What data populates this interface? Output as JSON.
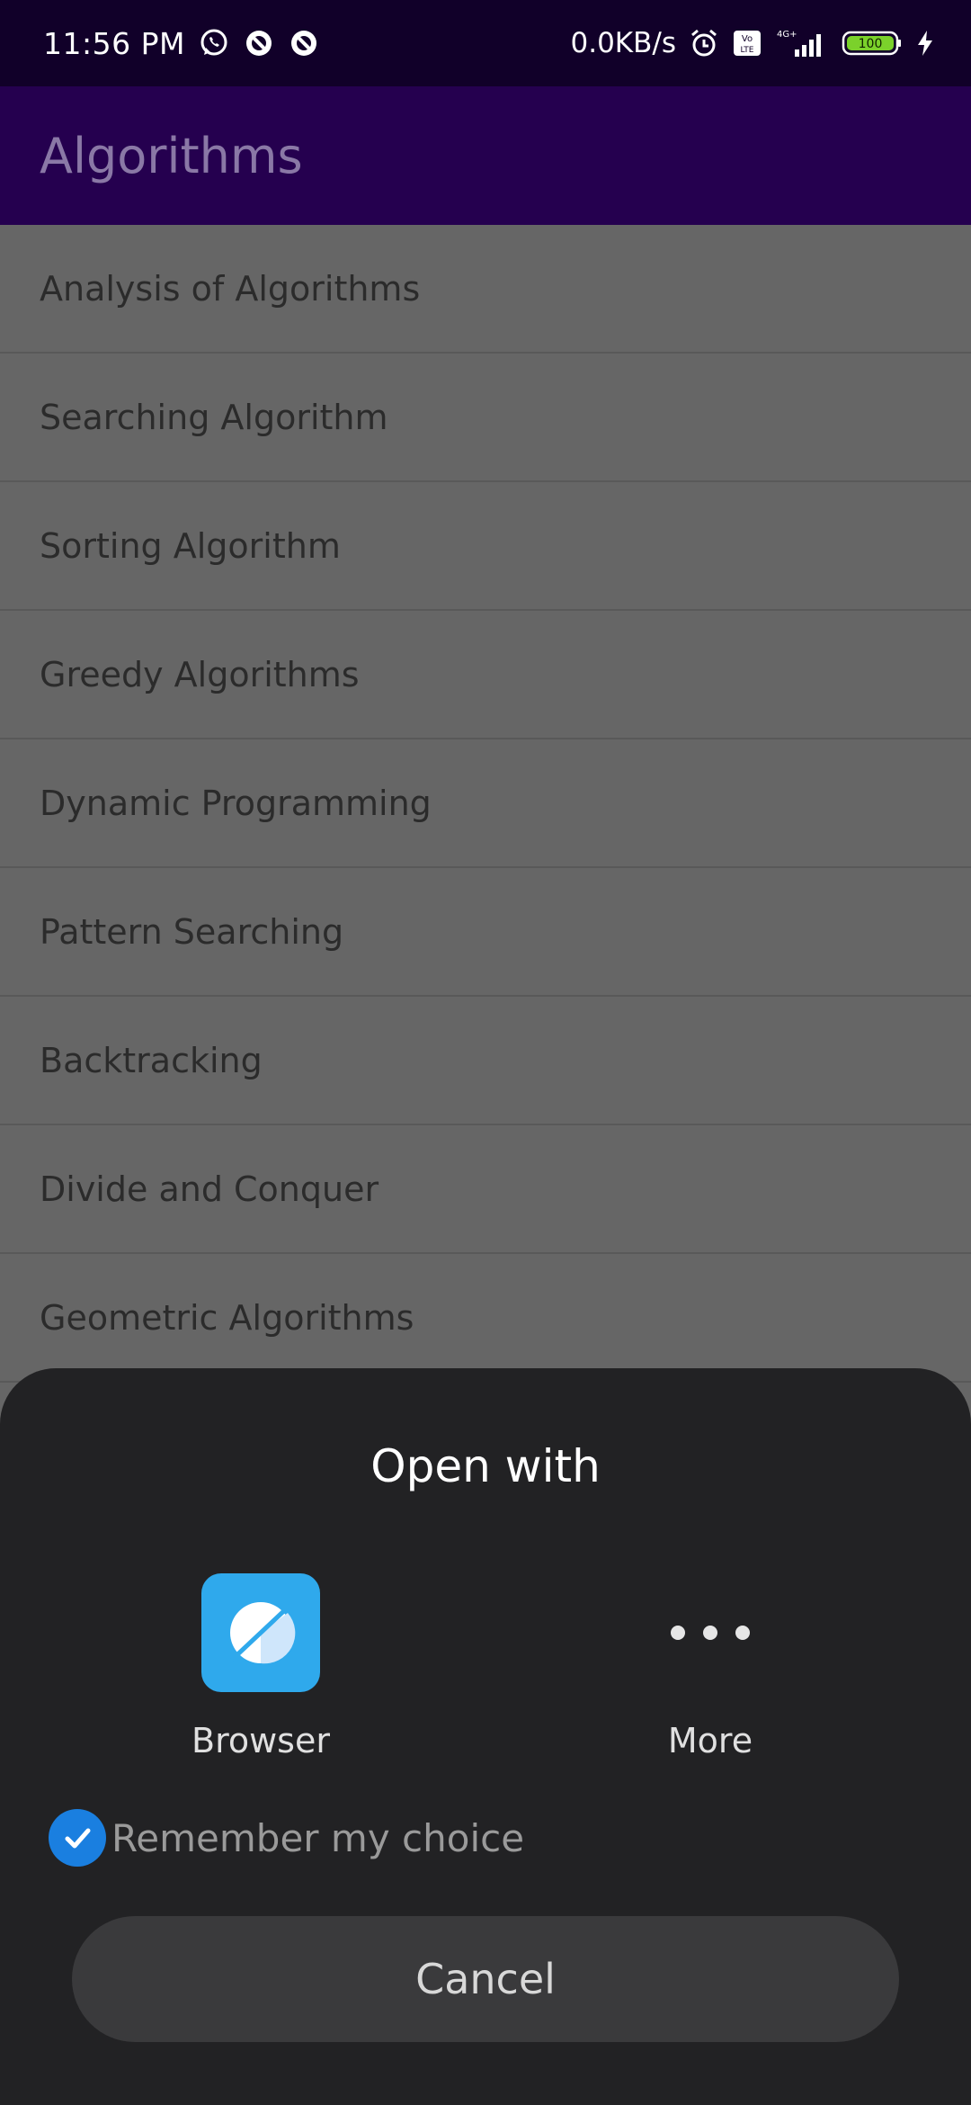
{
  "status_bar": {
    "time": "11:56 PM",
    "net_speed": "0.0KB/s",
    "network_type": "4G+",
    "volte": "Vo LTE",
    "battery": "100",
    "icons": [
      "whatsapp-icon",
      "notification-icon",
      "notification-icon",
      "alarm-icon",
      "volte-icon",
      "signal-icon",
      "battery-icon",
      "charging-icon"
    ]
  },
  "app_bar": {
    "title": "Algorithms"
  },
  "list": {
    "items": [
      {
        "label": "Analysis of Algorithms"
      },
      {
        "label": "Searching Algorithm"
      },
      {
        "label": "Sorting Algorithm"
      },
      {
        "label": "Greedy Algorithms"
      },
      {
        "label": "Dynamic Programming"
      },
      {
        "label": "Pattern Searching"
      },
      {
        "label": "Backtracking"
      },
      {
        "label": "Divide and Conquer"
      },
      {
        "label": "Geometric Algorithms"
      }
    ]
  },
  "sheet": {
    "title": "Open with",
    "apps": [
      {
        "label": "Browser",
        "icon": "browser-icon"
      },
      {
        "label": "More",
        "icon": "more-icon"
      }
    ],
    "remember_label": "Remember my choice",
    "remember_checked": true,
    "cancel_label": "Cancel"
  },
  "colors": {
    "status_bar_bg": "#110029",
    "app_bar_bg": "#25004f",
    "sheet_bg": "#222224",
    "accent_blue": "#1a7fe0",
    "browser_icon_bg": "#2fa9ec",
    "battery_green": "#7bd12b"
  }
}
